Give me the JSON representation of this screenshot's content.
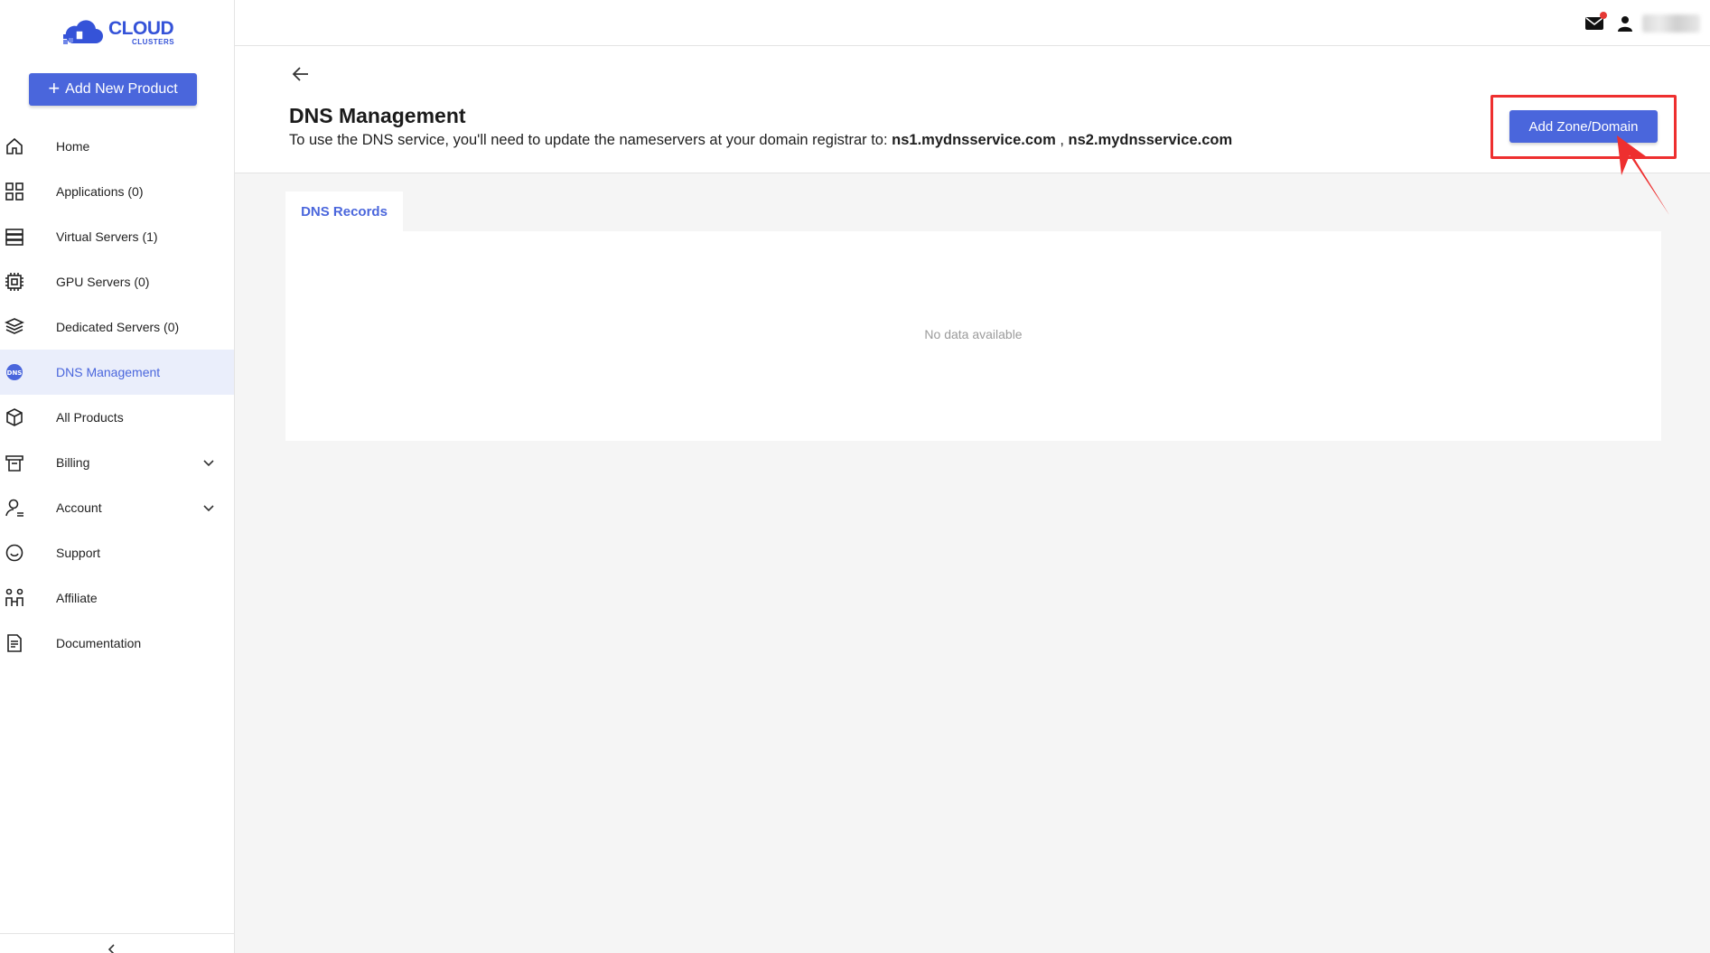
{
  "brand": {
    "logo_main": "CLOUD",
    "logo_sub": "CLUSTERS",
    "accent_color": "#4a66dc"
  },
  "sidebar": {
    "add_product_label": "Add New Product",
    "items": [
      {
        "label": "Home",
        "icon": "home-icon"
      },
      {
        "label": "Applications (0)",
        "icon": "apps-grid-icon"
      },
      {
        "label": "Virtual Servers (1)",
        "icon": "server-stack-icon"
      },
      {
        "label": "GPU Servers (0)",
        "icon": "chip-icon"
      },
      {
        "label": "Dedicated Servers (0)",
        "icon": "layers-icon"
      },
      {
        "label": "DNS Management",
        "icon": "dns-globe-icon",
        "active": true
      },
      {
        "label": "All Products",
        "icon": "box-icon"
      },
      {
        "label": "Billing",
        "icon": "receipt-icon",
        "expandable": true
      },
      {
        "label": "Account",
        "icon": "user-outline-icon",
        "expandable": true
      },
      {
        "label": "Support",
        "icon": "smile-chat-icon"
      },
      {
        "label": "Affiliate",
        "icon": "affiliate-icon"
      },
      {
        "label": "Documentation",
        "icon": "document-icon"
      }
    ]
  },
  "topbar": {
    "mail_icon": "mail-icon",
    "user_icon": "user-icon",
    "username": "········"
  },
  "header": {
    "title": "DNS Management",
    "desc_prefix": "To use the DNS service, you'll need to update the nameservers at your domain registrar to: ",
    "ns1": "ns1.mydnsservice.com",
    "separator": " , ",
    "ns2": "ns2.mydnsservice.com",
    "add_zone_label": "Add Zone/Domain"
  },
  "tabs": [
    {
      "label": "DNS Records",
      "active": true
    }
  ],
  "content": {
    "empty_text": "No data available"
  },
  "annotation": {
    "highlight_color": "#ee2f2f"
  }
}
